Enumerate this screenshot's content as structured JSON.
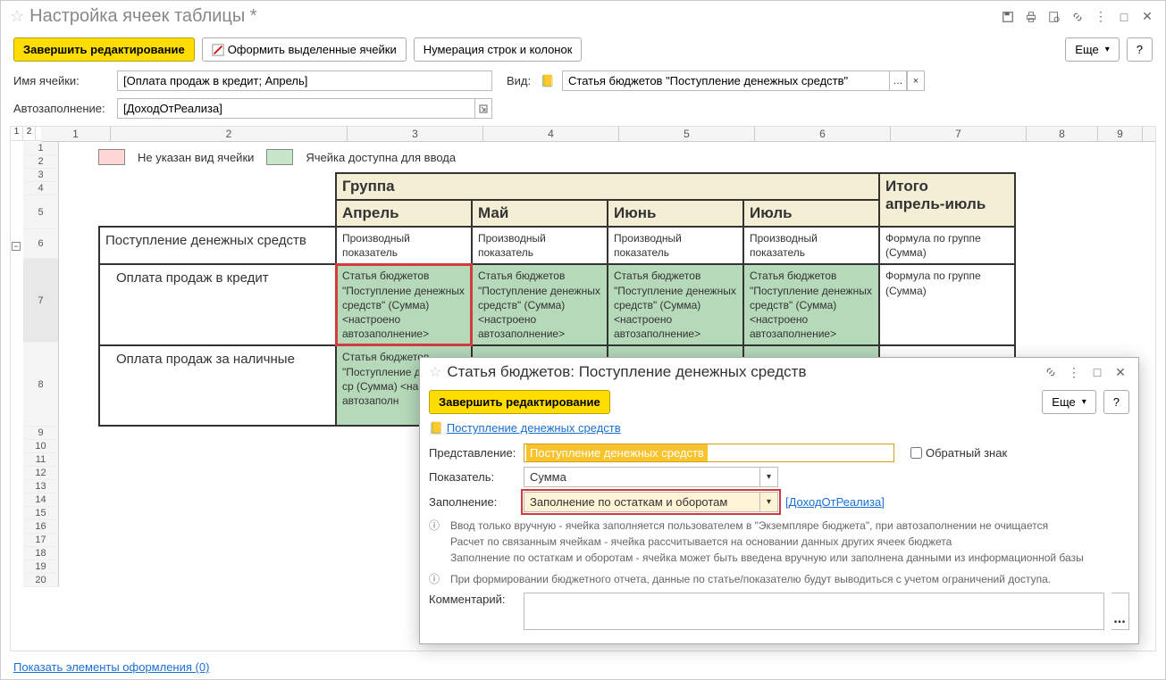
{
  "window": {
    "title": "Настройка ячеек таблицы *"
  },
  "toolbar": {
    "finish": "Завершить редактирование",
    "format_cells": "Оформить выделенные ячейки",
    "numbering": "Нумерация строк и колонок",
    "more": "Еще",
    "help": "?"
  },
  "labels": {
    "cell_name": "Имя ячейки:",
    "kind": "Вид:",
    "autofill": "Автозаполнение:"
  },
  "values": {
    "cell_name": "[Оплата продаж в кредит; Апрель]",
    "kind": "Статья бюджетов \"Поступление денежных средств\"",
    "autofill": "[ДоходОтРеализа]"
  },
  "sheet": {
    "tabs": [
      "1",
      "2"
    ],
    "col_headers": [
      "",
      "1",
      "2",
      "3",
      "4",
      "5",
      "6",
      "7",
      "8",
      "9"
    ],
    "row_nums_top": [
      "1",
      "2",
      "3",
      "4",
      "5"
    ],
    "row_nums_mid": [
      "6",
      "7",
      "8"
    ],
    "row_nums_bottom": [
      "9",
      "10",
      "11",
      "12",
      "13",
      "14",
      "15",
      "16",
      "17",
      "18",
      "19",
      "20"
    ]
  },
  "legend": {
    "no_type": "Не указан вид ячейки",
    "editable": "Ячейка доступна для ввода"
  },
  "table": {
    "group": "Группа",
    "months": [
      "Апрель",
      "Май",
      "Июнь",
      "Июль"
    ],
    "total_header_l1": "Итого",
    "total_header_l2": "апрель-июль",
    "rows": [
      {
        "name": "Поступление денежных средств",
        "cells": [
          "Производный показатель",
          "Производный показатель",
          "Производный показатель",
          "Производный показатель",
          "Формула по группе (Сумма)"
        ]
      },
      {
        "name": "Оплата продаж в кредит",
        "cells": [
          "Статья бюджетов \"Поступление денежных средств\" (Сумма) <настроено автозаполнение>",
          "Статья бюджетов \"Поступление денежных средств\" (Сумма) <настроено автозаполнение>",
          "Статья бюджетов \"Поступление денежных средств\" (Сумма) <настроено автозаполнение>",
          "Статья бюджетов \"Поступление денежных средств\" (Сумма) <настроено автозаполнение>",
          "Формула по группе (Сумма)"
        ]
      },
      {
        "name": "Оплата продаж за наличные",
        "cells_visible": [
          "Статья бюджетов \"Поступление денежных ср (Сумма) <настроено автозаполн"
        ]
      }
    ]
  },
  "footer": {
    "link": "Показать элементы оформления (0)"
  },
  "popup": {
    "title": "Статья бюджетов: Поступление денежных средств",
    "finish": "Завершить редактирование",
    "more": "Еще",
    "help": "?",
    "link_top": "Поступление денежных средств",
    "presentation_label": "Представление:",
    "presentation_value": "Поступление денежных средств",
    "reverse_sign": "Обратный знак",
    "indicator_label": "Показатель:",
    "indicator_value": "Сумма",
    "fill_label": "Заполнение:",
    "fill_value": "Заполнение по остаткам и оборотам",
    "fill_link": "[ДоходОтРеализа]",
    "info1": "Ввод только вручную - ячейка заполняется пользователем в \"Экземпляре бюджета\", при автозаполнении не очищается\nРасчет по связанным ячейкам - ячейка рассчитывается на основании данных других ячеек бюджета\nЗаполнение по остаткам и оборотам - ячейка может быть введена вручную или заполнена данными из информационной базы",
    "info2": "При формировании бюджетного отчета, данные по статье/показателю будут выводиться с учетом ограничений доступа.",
    "comment_label": "Комментарий:"
  }
}
